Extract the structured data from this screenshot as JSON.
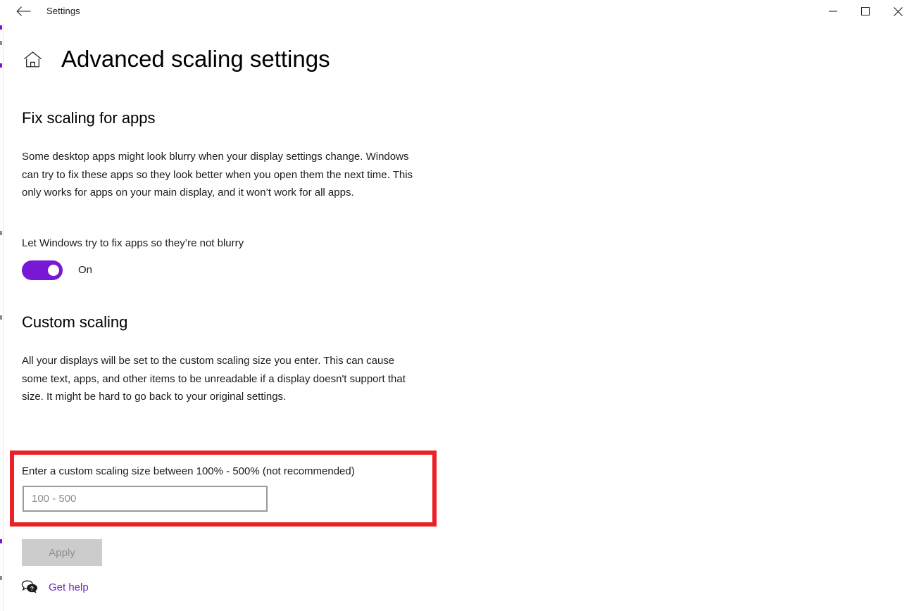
{
  "window": {
    "app_title": "Settings",
    "back_icon": "back-arrow-icon",
    "minimize_icon": "minimize-icon",
    "maximize_icon": "maximize-icon",
    "close_icon": "close-icon"
  },
  "page": {
    "home_icon": "home-icon",
    "title": "Advanced scaling settings"
  },
  "fix_scaling": {
    "heading": "Fix scaling for apps",
    "description": "Some desktop apps might look blurry when your display settings change. Windows can try to fix these apps so they look better when you open them the next time. This only works for apps on your main display, and it won’t work for all apps.",
    "toggle_label": "Let Windows try to fix apps so they’re not blurry",
    "toggle_state": "On",
    "toggle_on": true,
    "toggle_accent_color": "#7719d4"
  },
  "custom_scaling": {
    "heading": "Custom scaling",
    "description": "All your displays will be set to the custom scaling size you enter. This can cause some text, apps, and other items to be unreadable if a display doesn't support that size. It might be hard to go back to your original settings.",
    "field_label": "Enter a custom scaling size between 100% - 500% (not recommended)",
    "input_value": "",
    "input_placeholder": "100 - 500",
    "apply_label": "Apply",
    "apply_enabled": false
  },
  "footer": {
    "help_icon": "help-bubble-icon",
    "help_label": "Get help",
    "help_link_color": "#7126c4"
  },
  "annotation": {
    "highlight_color": "#ec2027",
    "highlight_target": "custom-scaling-input-field"
  }
}
